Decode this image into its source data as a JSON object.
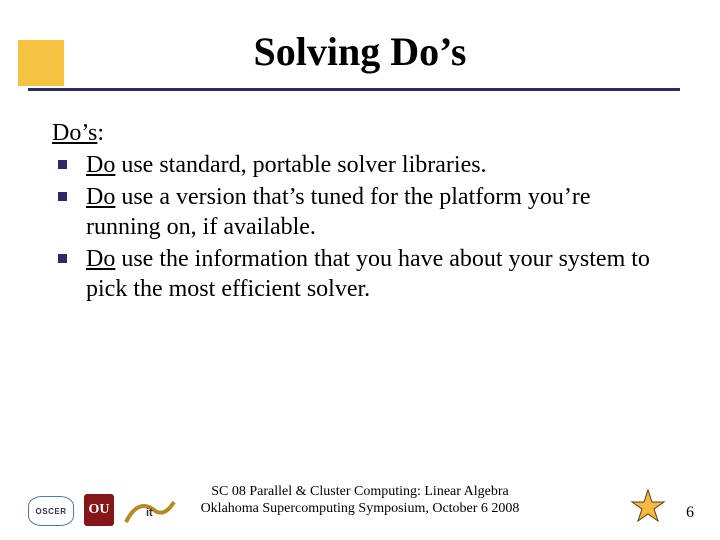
{
  "title": "Solving Do’s",
  "heading_do": "Do’s",
  "heading_colon": ":",
  "bullets": [
    {
      "do": "Do",
      "rest": " use standard, portable solver libraries."
    },
    {
      "do": "Do",
      "rest": " use a version that’s tuned for the platform you’re running on, if available."
    },
    {
      "do": "Do",
      "rest": " use the information that you have about your system to pick the most efficient solver."
    }
  ],
  "footer": {
    "line1": "SC 08 Parallel & Cluster Computing: Linear Algebra",
    "line2": "Oklahoma Supercomputing Symposium, October 6 2008"
  },
  "page_number": "6",
  "logos": {
    "oscer": "OSCER",
    "ou": "OU"
  }
}
